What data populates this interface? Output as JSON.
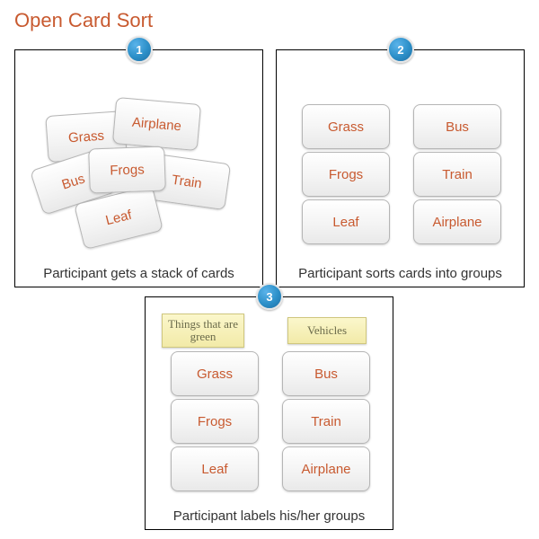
{
  "title": "Open Card Sort",
  "steps": [
    {
      "number": "1",
      "caption": "Participant gets a stack of cards",
      "cards": [
        "Grass",
        "Airplane",
        "Bus",
        "Frogs",
        "Train",
        "Leaf"
      ]
    },
    {
      "number": "2",
      "caption": "Participant sorts cards into groups",
      "groups": [
        {
          "cards": [
            "Grass",
            "Frogs",
            "Leaf"
          ]
        },
        {
          "cards": [
            "Bus",
            "Train",
            "Airplane"
          ]
        }
      ]
    },
    {
      "number": "3",
      "caption": "Participant labels his/her groups",
      "groups": [
        {
          "label": "Things that are green",
          "cards": [
            "Grass",
            "Frogs",
            "Leaf"
          ]
        },
        {
          "label": "Vehicles",
          "cards": [
            "Bus",
            "Train",
            "Airplane"
          ]
        }
      ]
    }
  ]
}
